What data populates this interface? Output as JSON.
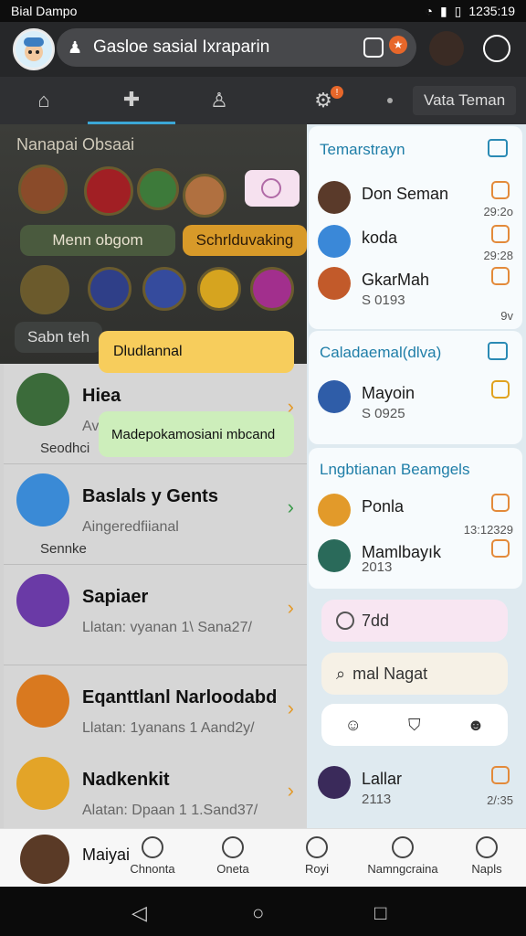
{
  "status": {
    "carrier": "Bial Dampo",
    "time": "1235:19"
  },
  "search": {
    "text": "Gasloe sasial Ixraparin"
  },
  "tabs": {
    "more_label": "Vata Teman",
    "active_index": 1
  },
  "games": {
    "title": "Nanapai Obsaai",
    "btn1": "Menn obgom",
    "btn2": "Schrlduvaking",
    "bottom_label": "Sabn teh"
  },
  "bubbles": {
    "yellow": "Dludlannal",
    "green": "Madepokamosiani mbcand"
  },
  "list": [
    {
      "name": "Hiea",
      "sub": "Av",
      "meta": "Seodhci"
    },
    {
      "name": "Baslals y Gents",
      "sub": "Aingeredfiianal",
      "meta": "Sennke"
    },
    {
      "name": "Sapiaer",
      "sub": "Llatan: vyanan 1\\ Sana27/",
      "meta": ""
    },
    {
      "name": "Eqanttlanl Narloodabd",
      "sub": "Llatan: 1yanans 1 Aand2y/",
      "meta": ""
    },
    {
      "name": "Nadkenkit",
      "sub": "Alatan: Dpaan 1 1.Sand37/",
      "meta": ""
    }
  ],
  "drawer": {
    "section1": {
      "title": "Temarstrayn",
      "items": [
        {
          "name": "Don Seman",
          "time": "29:2o",
          "sub": ""
        },
        {
          "name": "koda",
          "time": "29:28",
          "sub": ""
        },
        {
          "name": "GkarMah",
          "time": "9v",
          "sub": "S 0193"
        }
      ]
    },
    "section2": {
      "title": "Caladaemal(dlva)",
      "items": [
        {
          "name": "Mayoin",
          "sub": "S 0925"
        }
      ]
    },
    "section3": {
      "title": "Lngbtianan Beamgels",
      "items": [
        {
          "name": "Ponla",
          "time": "13:12329",
          "sub": ""
        },
        {
          "name": "Mamlbayık",
          "time": "",
          "sub": "2013"
        }
      ]
    },
    "pills": [
      "7dd",
      "mal Nagat",
      ""
    ],
    "after": {
      "name": "Lallar",
      "time": "2/:35",
      "sub": "2113"
    }
  },
  "bottomnav": {
    "me_name": "Maiyai",
    "items": [
      "Chnonta",
      "Oneta",
      "Royi",
      "Namngcraina",
      "Napls"
    ]
  }
}
